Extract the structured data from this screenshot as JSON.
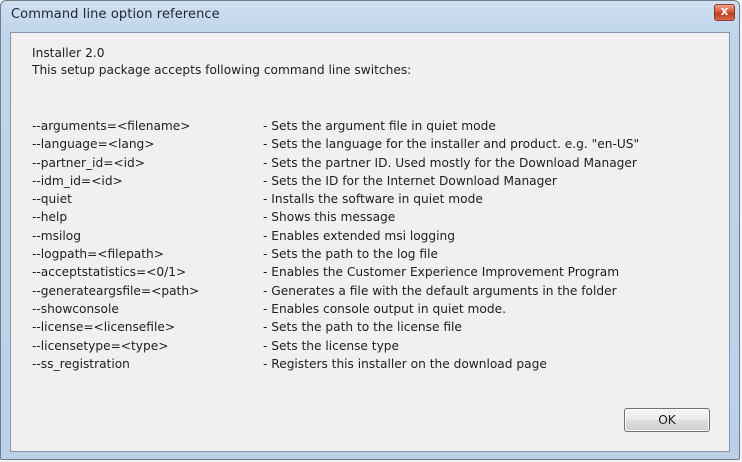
{
  "window": {
    "title": "Command  line option reference",
    "close_label": "x"
  },
  "header": {
    "product": "Installer 2.0",
    "intro": "This setup package accepts following command line switches:"
  },
  "switches": [
    {
      "name": "--arguments=<filename>",
      "description": "- Sets the argument file in quiet mode"
    },
    {
      "name": "--language=<lang>",
      "description": "- Sets the language for the installer and product. e.g. \"en-US\""
    },
    {
      "name": "--partner_id=<id>",
      "description": "- Sets the partner ID. Used mostly for the Download Manager"
    },
    {
      "name": "--idm_id=<id>",
      "description": "- Sets the ID for the Internet Download Manager"
    },
    {
      "name": "--quiet",
      "description": "- Installs the software in quiet mode"
    },
    {
      "name": "--help",
      "description": "- Shows this message"
    },
    {
      "name": "--msilog",
      "description": "- Enables extended msi logging"
    },
    {
      "name": "--logpath=<filepath>",
      "description": "- Sets the path to the log file"
    },
    {
      "name": "--acceptstatistics=<0/1>",
      "description": "- Enables the Customer Experience Improvement Program"
    },
    {
      "name": "--generateargsfile=<path>",
      "description": "- Generates a file with the default arguments in the folder"
    },
    {
      "name": "--showconsole",
      "description": "- Enables console output in quiet mode."
    },
    {
      "name": "--license=<licensefile>",
      "description": "- Sets the path to the license file"
    },
    {
      "name": "--licensetype=<type>",
      "description": "- Sets the license type"
    },
    {
      "name": "--ss_registration",
      "description": "- Registers this installer on the download page"
    }
  ],
  "buttons": {
    "ok_label": "OK"
  }
}
